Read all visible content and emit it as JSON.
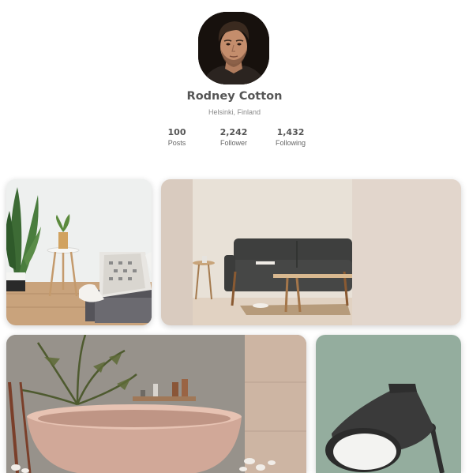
{
  "profile": {
    "name": "Rodney Cotton",
    "location": "Helsinki, Finland",
    "stats": [
      {
        "value": "100",
        "label": "Posts"
      },
      {
        "value": "2,242",
        "label": "Follower"
      },
      {
        "value": "1,432",
        "label": "Following"
      }
    ]
  },
  "gallery": {
    "photos": [
      {
        "subject": "bedroom-with-plant"
      },
      {
        "subject": "living-room-sofa"
      },
      {
        "subject": "bathroom-bathtub"
      },
      {
        "subject": "desk-lamp"
      }
    ]
  }
}
